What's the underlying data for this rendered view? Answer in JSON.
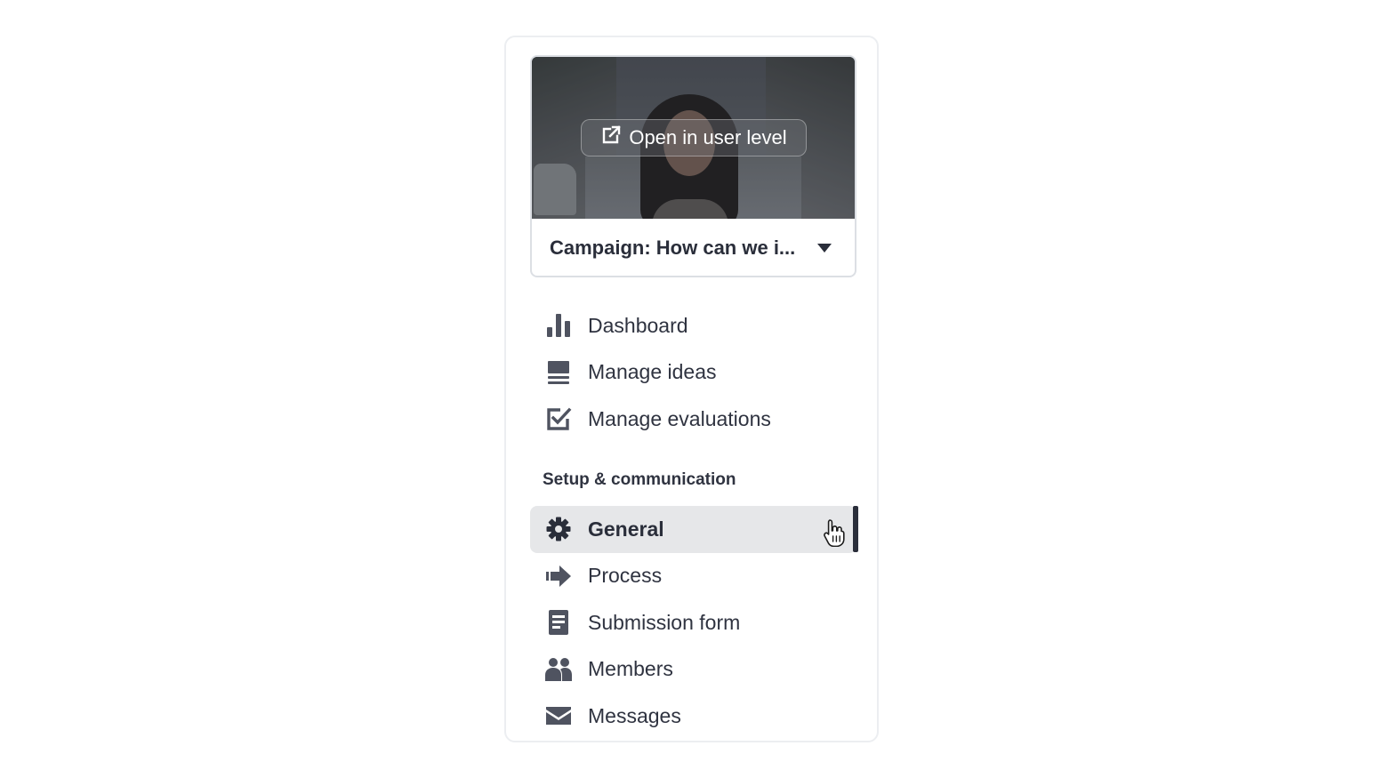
{
  "campaign": {
    "open_button_label": "Open in user level",
    "selected": "Campaign: How can we i..."
  },
  "nav": {
    "main_items": [
      {
        "label": "Dashboard",
        "icon": "bar-chart-icon"
      },
      {
        "label": "Manage ideas",
        "icon": "ideas-list-icon"
      },
      {
        "label": "Manage evaluations",
        "icon": "checkbox-icon"
      }
    ],
    "section_title": "Setup & communication",
    "setup_items": [
      {
        "label": "General",
        "icon": "gear-icon",
        "active": true
      },
      {
        "label": "Process",
        "icon": "arrow-right-icon"
      },
      {
        "label": "Submission form",
        "icon": "form-icon"
      },
      {
        "label": "Members",
        "icon": "people-icon"
      },
      {
        "label": "Messages",
        "icon": "envelope-icon"
      }
    ]
  },
  "colors": {
    "active_background": "#e6e7e9",
    "active_bar": "#2a2e3a",
    "icon": "#4f5360",
    "text": "#2f3340"
  }
}
